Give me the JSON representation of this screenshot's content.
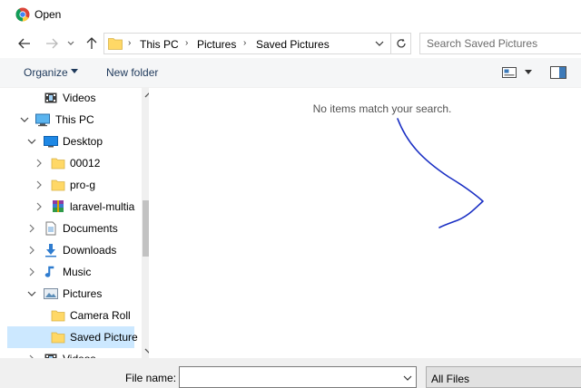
{
  "window": {
    "title": "Open",
    "logo_icon": "chrome-logo-icon"
  },
  "nav": {
    "back_icon": "arrow-left-icon",
    "forward_icon": "arrow-right-icon",
    "recent_icon": "chevron-down-icon",
    "up_icon": "arrow-up-icon"
  },
  "address": {
    "breadcrumbs": [
      "This PC",
      "Pictures",
      "Saved Pictures"
    ],
    "separator": "›",
    "refresh_icon": "refresh-icon"
  },
  "search": {
    "placeholder": "Search Saved Pictures",
    "value": ""
  },
  "toolbar": {
    "organize_label": "Organize",
    "new_folder_label": "New folder",
    "view_icon": "view-options-icon",
    "preview_icon": "preview-pane-icon"
  },
  "tree": [
    {
      "label": "Videos",
      "icon": "videos-folder-icon",
      "chevron": "none",
      "level": 1
    },
    {
      "label": "This PC",
      "icon": "computer-icon",
      "chevron": "expanded",
      "level": 0
    },
    {
      "label": "Desktop",
      "icon": "desktop-icon",
      "chevron": "expanded",
      "level": 1
    },
    {
      "label": "00012",
      "icon": "folder-icon",
      "chevron": "collapsed",
      "level": 2
    },
    {
      "label": "pro-g",
      "icon": "folder-icon",
      "chevron": "collapsed",
      "level": 2
    },
    {
      "label": "laravel-multia",
      "icon": "archive-icon",
      "chevron": "collapsed",
      "level": 2
    },
    {
      "label": "Documents",
      "icon": "documents-icon",
      "chevron": "collapsed",
      "level": 1
    },
    {
      "label": "Downloads",
      "icon": "downloads-icon",
      "chevron": "collapsed",
      "level": 1
    },
    {
      "label": "Music",
      "icon": "music-icon",
      "chevron": "collapsed",
      "level": 1
    },
    {
      "label": "Pictures",
      "icon": "pictures-icon",
      "chevron": "expanded",
      "level": 1
    },
    {
      "label": "Camera Roll",
      "icon": "folder-icon",
      "chevron": "none",
      "level": 2
    },
    {
      "label": "Saved Picture",
      "icon": "folder-icon",
      "chevron": "none",
      "level": 2,
      "selected": true
    },
    {
      "label": "Videos",
      "icon": "videos-folder-icon",
      "chevron": "collapsed",
      "level": 1
    }
  ],
  "content": {
    "empty_message": "No items match your search."
  },
  "footer": {
    "file_name_label": "File name:",
    "file_name_value": "",
    "file_type": "All Files"
  },
  "colors": {
    "selected_bg": "#cce8ff",
    "toolbar_bg": "#f5f6f7",
    "link_text": "#1e395b",
    "scribble": "#1a2fc4"
  }
}
